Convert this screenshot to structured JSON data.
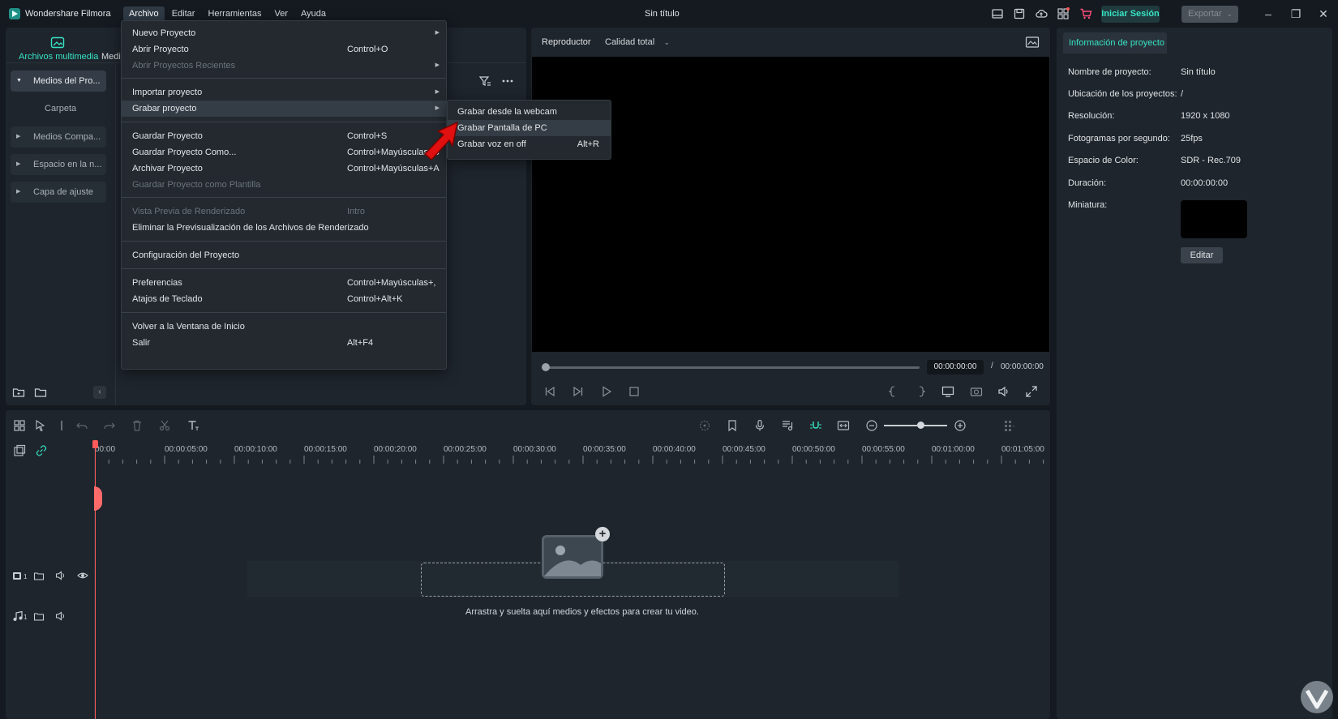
{
  "app": {
    "name": "Wondershare Filmora",
    "document_title": "Sin título"
  },
  "menubar": [
    {
      "label": "Archivo",
      "active": true
    },
    {
      "label": "Editar"
    },
    {
      "label": "Herramientas"
    },
    {
      "label": "Ver"
    },
    {
      "label": "Ayuda"
    }
  ],
  "titlebar": {
    "login_label": "Iniciar Sesión",
    "export_label": "Exportar"
  },
  "media": {
    "tab_label": "Archivos multimedia",
    "tab2_label": "Medi",
    "sidebar": [
      {
        "label": "Medios del Pro..."
      },
      {
        "label": "Carpeta"
      },
      {
        "label": "Medios Compa..."
      },
      {
        "label": "Espacio en la n..."
      },
      {
        "label": "Capa de ajuste"
      }
    ]
  },
  "file_menu": {
    "items": [
      {
        "label": "Nuevo Proyecto",
        "shortcut": "",
        "submenu": true
      },
      {
        "label": "Abrir Proyecto",
        "shortcut": "Control+O"
      },
      {
        "label": "Abrir Proyectos Recientes",
        "shortcut": "",
        "submenu": true,
        "disabled": true
      },
      {
        "label": "Importar proyecto",
        "shortcut": "",
        "submenu": true
      },
      {
        "label": "Grabar proyecto",
        "shortcut": "",
        "submenu": true,
        "hover": true
      },
      {
        "label": "Guardar Proyecto",
        "shortcut": "Control+S"
      },
      {
        "label": "Guardar Proyecto Como...",
        "shortcut": "Control+Mayúsculas+S"
      },
      {
        "label": "Archivar Proyecto",
        "shortcut": "Control+Mayúsculas+A"
      },
      {
        "label": "Guardar Proyecto como Plantilla",
        "shortcut": "",
        "disabled": true
      },
      {
        "label": "Vista Previa de Renderizado",
        "shortcut": "Intro",
        "disabled": true
      },
      {
        "label": "Eliminar la Previsualización de los Archivos de Renderizado",
        "shortcut": ""
      },
      {
        "label": "Configuración del Proyecto",
        "shortcut": ""
      },
      {
        "label": "Preferencias",
        "shortcut": "Control+Mayúsculas+,"
      },
      {
        "label": "Atajos de Teclado",
        "shortcut": "Control+Alt+K"
      },
      {
        "label": "Volver a la Ventana de Inicio",
        "shortcut": ""
      },
      {
        "label": "Salir",
        "shortcut": "Alt+F4"
      }
    ]
  },
  "record_submenu": {
    "items": [
      {
        "label": "Grabar desde la webcam",
        "shortcut": ""
      },
      {
        "label": "Grabar Pantalla de PC",
        "shortcut": "",
        "hover": true
      },
      {
        "label": "Grabar voz en off",
        "shortcut": "Alt+R"
      }
    ]
  },
  "player": {
    "label": "Reproductor",
    "quality": "Calidad total",
    "time_current": "00:00:00:00",
    "time_separator": "/",
    "time_total": "00:00:00:00"
  },
  "project_info": {
    "tab_label": "Información de proyecto",
    "rows": [
      {
        "label": "Nombre de proyecto:",
        "value": "Sin título"
      },
      {
        "label": "Ubicación de los proyectos:",
        "value": "/"
      },
      {
        "label": "Resolución:",
        "value": "1920 x 1080"
      },
      {
        "label": "Fotogramas por segundo:",
        "value": "25fps"
      },
      {
        "label": "Espacio de Color:",
        "value": "SDR - Rec.709"
      },
      {
        "label": "Duración:",
        "value": "00:00:00:00"
      },
      {
        "label": "Miniatura:",
        "value": ""
      }
    ],
    "edit_label": "Editar"
  },
  "timeline": {
    "ruler_labels": [
      "00:00",
      "00:00:05:00",
      "00:00:10:00",
      "00:00:15:00",
      "00:00:20:00",
      "00:00:25:00",
      "00:00:30:00",
      "00:00:35:00",
      "00:00:40:00",
      "00:00:45:00",
      "00:00:50:00",
      "00:00:55:00",
      "00:01:00:00",
      "00:01:05:00"
    ],
    "video_track_number": "1",
    "audio_track_number": "1",
    "drop_hint": "Arrastra y suelta aquí medios y efectos para crear tu video."
  },
  "colors": {
    "accent": "#38e3c5",
    "playhead": "#ff5a5a",
    "annotation_arrow": "#e01010"
  }
}
